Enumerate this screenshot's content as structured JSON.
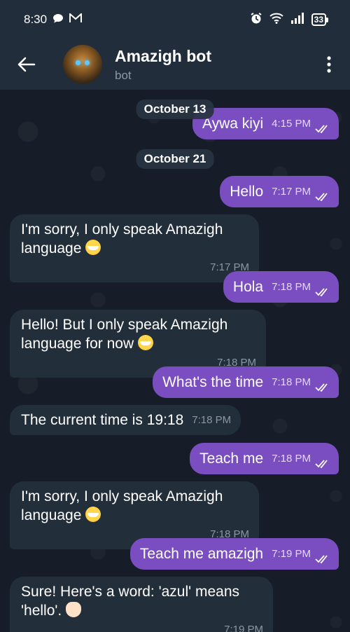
{
  "status_bar": {
    "time": "8:30",
    "battery": "33"
  },
  "header": {
    "title": "Amazigh bot",
    "subtitle": "bot"
  },
  "dates": [
    "October 13",
    "October 21"
  ],
  "messages": [
    {
      "dir": "out",
      "text": "Aywa kiyi",
      "time": "4:15 PM"
    },
    {
      "dir": "out",
      "text": "Hello",
      "time": "7:17 PM"
    },
    {
      "dir": "in",
      "text": "I'm sorry, I only speak Amazigh language",
      "emoji": "sweat-smile",
      "time": "7:17 PM"
    },
    {
      "dir": "out",
      "text": "Hola",
      "time": "7:18 PM"
    },
    {
      "dir": "in",
      "text": "Hello! But I only speak Amazigh language for now",
      "emoji": "sweat-smile",
      "time": "7:18 PM"
    },
    {
      "dir": "out",
      "text": "What's the time",
      "time": "7:18 PM"
    },
    {
      "dir": "in",
      "text": "The current time is 19:18",
      "time": "7:18 PM"
    },
    {
      "dir": "out",
      "text": "Teach me",
      "time": "7:18 PM"
    },
    {
      "dir": "in",
      "text": "I'm sorry, I only speak Amazigh language",
      "emoji": "sweat-smile",
      "time": "7:18 PM"
    },
    {
      "dir": "out",
      "text": "Teach me amazigh",
      "time": "7:19 PM"
    },
    {
      "dir": "in",
      "text": "Sure! Here's a word: 'azul' means 'hello'.",
      "emoji": "waving-hand",
      "time": "7:19 PM"
    }
  ],
  "colors": {
    "background": "#161d28",
    "header": "#212d3b",
    "outgoing_bubble": "#7a4ec0",
    "incoming_bubble": "#232e3b"
  }
}
